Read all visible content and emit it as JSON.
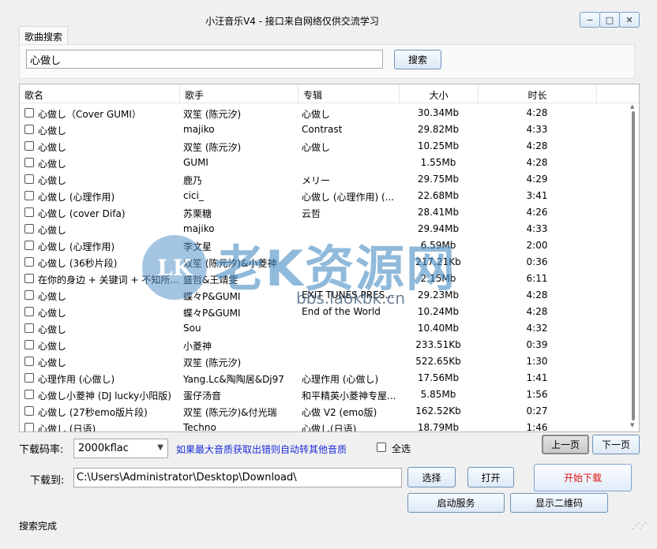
{
  "window": {
    "title": "小汪音乐V4 - 接口来自网络仅供交流学习",
    "min_glyph": "−",
    "max_glyph": "□",
    "close_glyph": "✕"
  },
  "search": {
    "tab_label": "歌曲搜索",
    "query": "心做し",
    "button_label": "搜索"
  },
  "table": {
    "headers": [
      "歌名",
      "歌手",
      "专辑",
      "大小",
      "时长"
    ],
    "rows": [
      {
        "name": "心做し（Cover GUMI）",
        "artist": "双笙 (陈元汐)",
        "album": "心做し",
        "size": "30.34Mb",
        "time": "4:28"
      },
      {
        "name": "心做し",
        "artist": "majiko",
        "album": "Contrast",
        "size": "29.82Mb",
        "time": "4:33"
      },
      {
        "name": "心做し",
        "artist": "双笙 (陈元汐)",
        "album": "心做し",
        "size": "10.25Mb",
        "time": "4:28"
      },
      {
        "name": "心做し",
        "artist": "GUMI",
        "album": "",
        "size": "1.55Mb",
        "time": "4:28"
      },
      {
        "name": "心做し",
        "artist": "鹿乃",
        "album": "メリー",
        "size": "29.75Mb",
        "time": "4:29"
      },
      {
        "name": "心做し (心理作用)",
        "artist": "cici_",
        "album": "心做し (心理作用) (...",
        "size": "22.68Mb",
        "time": "3:41"
      },
      {
        "name": "心做し (cover Difa)",
        "artist": "苏栗糖",
        "album": "云哲",
        "size": "28.41Mb",
        "time": "4:26"
      },
      {
        "name": "心做し",
        "artist": "majiko",
        "album": "",
        "size": "29.94Mb",
        "time": "4:33"
      },
      {
        "name": "心做し (心理作用)",
        "artist": "李文星",
        "album": "",
        "size": "6.59Mb",
        "time": "2:00"
      },
      {
        "name": "心做し (36秒片段)",
        "artist": "双笙 (陈元汐)&小菱神",
        "album": "",
        "size": "217.21Kb",
        "time": "0:36"
      },
      {
        "name": "在你的身边 + 关键词 + 不知所...",
        "artist": "盛哲&王靖雯",
        "album": "",
        "size": "2.15Mb",
        "time": "6:11"
      },
      {
        "name": "心做し",
        "artist": "蝶々P&GUMI",
        "album": "EXIT TUNES PRES...",
        "size": "29.23Mb",
        "time": "4:28"
      },
      {
        "name": "心做し",
        "artist": "蝶々P&GUMI",
        "album": "End of the World",
        "size": "10.24Mb",
        "time": "4:28"
      },
      {
        "name": "心做し",
        "artist": "Sou",
        "album": "",
        "size": "10.40Mb",
        "time": "4:32"
      },
      {
        "name": "心做し",
        "artist": "小菱神",
        "album": "",
        "size": "233.51Kb",
        "time": "0:39"
      },
      {
        "name": "心做し",
        "artist": "双笙 (陈元汐)",
        "album": "",
        "size": "522.65Kb",
        "time": "1:30"
      },
      {
        "name": "心理作用 (心做し)",
        "artist": "Yang.Lc&陶陶居&Dj97",
        "album": "心理作用 (心做し)",
        "size": "17.56Mb",
        "time": "1:41"
      },
      {
        "name": "心做し小菱神 (DJ lucky小阳版)",
        "artist": "蛋仔汤音",
        "album": "和平精英小菱神专屋...",
        "size": "5.85Mb",
        "time": "1:56"
      },
      {
        "name": "心做し (27秒emo版片段)",
        "artist": "双笙 (陈元汐)&付光瑞",
        "album": "心做 V2 (emo版)",
        "size": "162.52Kb",
        "time": "0:27"
      },
      {
        "name": "心做し (日语)",
        "artist": "Techno",
        "album": "心做し(日语)",
        "size": "18.79Mb",
        "time": "1:46"
      }
    ]
  },
  "watermark": {
    "logo": "LK",
    "text": "老K资源网",
    "url": "bbs.laokbk.cn"
  },
  "controls": {
    "bitrate_label": "下载码率:",
    "bitrate_value": "2000kflac",
    "hint": "如果最大音质获取出错则自动转其他音质",
    "select_all_label": "全选",
    "prev_label": "上一页",
    "next_label": "下一页",
    "download_to_label": "下载到:",
    "download_path": "C:\\Users\\Administrator\\Desktop\\Download\\",
    "choose_label": "选择",
    "open_label": "打开",
    "start_label": "开始下载",
    "service_label": "启动服务",
    "qr_label": "显示二维码"
  },
  "status": {
    "text": "搜索完成"
  },
  "colors": {
    "hint": "#1a2ed6",
    "start_button_text": "#e01414",
    "watermark": "#468cc3"
  }
}
